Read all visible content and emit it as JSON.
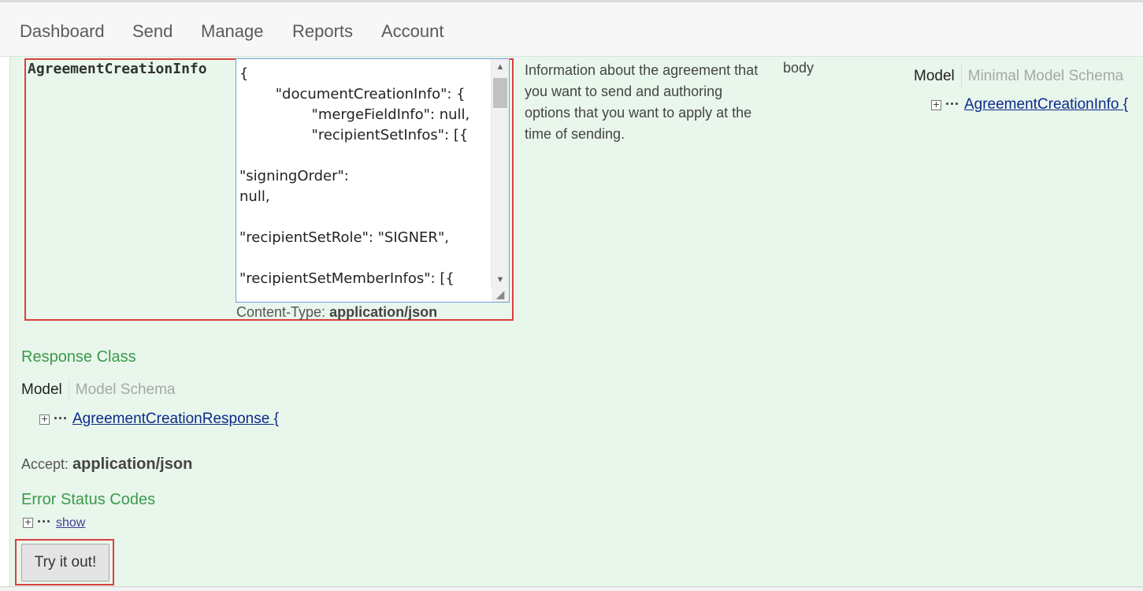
{
  "nav": {
    "items": [
      "Dashboard",
      "Send",
      "Manage",
      "Reports",
      "Account"
    ]
  },
  "parameter": {
    "name": "AgreementCreationInfo",
    "json_value": "{\n        \"documentCreationInfo\": {\n                \"mergeFieldInfo\": null,\n                \"recipientSetInfos\": [{\n                                \"signingOrder\":\nnull,\n\n\"recipientSetRole\": \"SIGNER\",\n\n\"recipientSetMemberInfos\": [{\n\n\"securityOptions\": null,",
    "content_type_label": "Content-Type:",
    "content_type_value": "application/json",
    "description": "Information about the agreement that you want to send and authoring options that you want to apply at the time of sending.",
    "param_type": "body",
    "model_tab": "Model",
    "schema_tab": "Minimal Model Schema",
    "model_link": "AgreementCreationInfo {"
  },
  "response": {
    "title": "Response Class",
    "model_tab": "Model",
    "schema_tab": "Model Schema",
    "model_link": "AgreementCreationResponse {"
  },
  "accept": {
    "label": "Accept:",
    "value": "application/json"
  },
  "errors": {
    "title": "Error Status Codes",
    "show_label": "show"
  },
  "try_button": {
    "label": "Try it out!"
  },
  "icons": {
    "expand": "plus-square-icon",
    "ellipsis": "ellipsis-icon",
    "scroll_up": "chevron-up-icon",
    "scroll_down": "chevron-down-icon",
    "resize": "resize-grip-icon"
  },
  "colors": {
    "section_title": "#3a9a4a",
    "panel_bg": "#e9f6ec",
    "highlight": "#d9413c",
    "link": "#0b2a8a"
  }
}
